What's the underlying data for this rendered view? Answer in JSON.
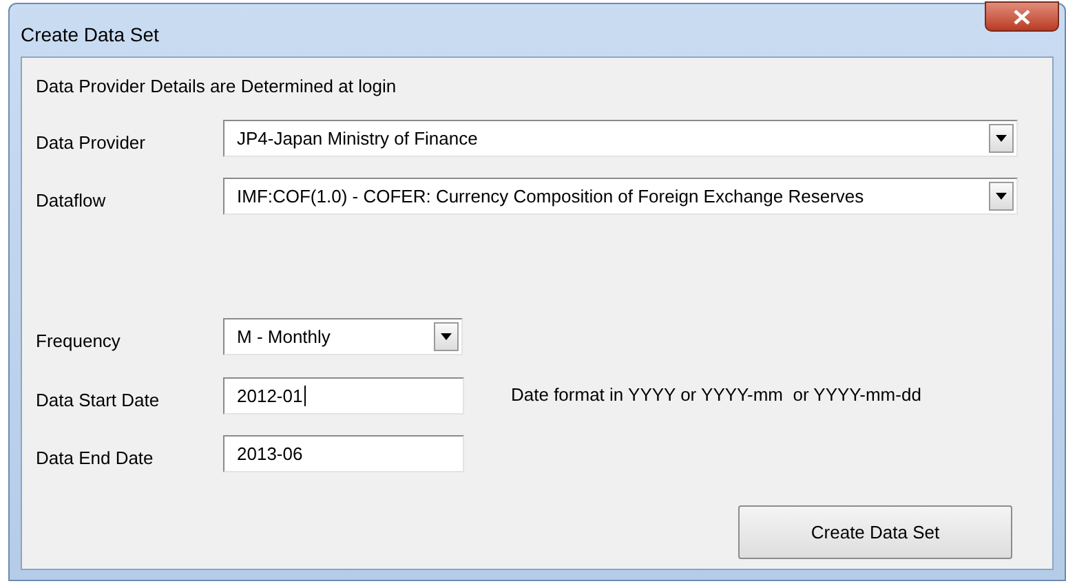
{
  "window": {
    "title": "Create Data Set"
  },
  "intro": "Data Provider Details are Determined at login",
  "fields": [
    {
      "kind": "dropdown",
      "label": "Data Provider",
      "value": "JP4-Japan Ministry of Finance",
      "focused": false
    },
    {
      "kind": "dropdown",
      "label": "Dataflow",
      "value": "IMF:COF(1.0) - COFER: Currency Composition of Foreign Exchange Reserves",
      "focused": false
    },
    {
      "kind": "dropdown",
      "label": "Frequency",
      "value": "M - Monthly",
      "focused": false
    },
    {
      "kind": "text",
      "label": "Data Start Date",
      "value": "2012-01",
      "focused": true,
      "hint": "Date format in YYYY or YYYY-mm  or YYYY-mm-dd"
    },
    {
      "kind": "text",
      "label": "Data End Date",
      "value": "2013-06",
      "focused": false
    }
  ],
  "button": "Create Data Set"
}
